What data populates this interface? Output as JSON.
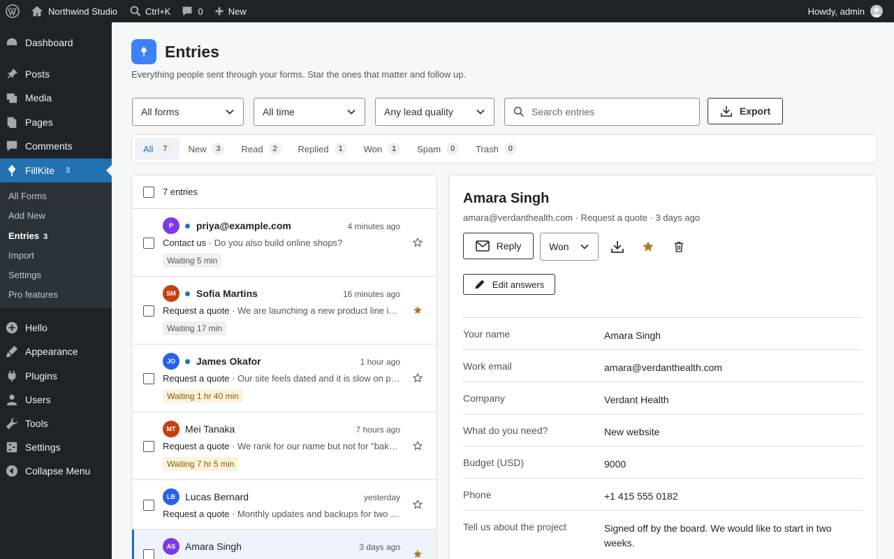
{
  "adminbar": {
    "site_name": "Northwind Studio",
    "search_shortcut": "Ctrl+K",
    "comments_count": "0",
    "new_label": "New",
    "howdy": "Howdy, admin"
  },
  "sidebar": {
    "items": [
      {
        "label": "Dashboard",
        "icon": "dashboard-icon"
      },
      {
        "label": "Posts",
        "icon": "pin-icon"
      },
      {
        "label": "Media",
        "icon": "media-icon"
      },
      {
        "label": "Pages",
        "icon": "pages-icon"
      },
      {
        "label": "Comments",
        "icon": "comment-icon"
      },
      {
        "label": "FillKite",
        "icon": "kite-icon",
        "count": "3"
      },
      {
        "label": "Hello",
        "icon": "plus-circle-icon"
      },
      {
        "label": "Appearance",
        "icon": "brush-icon"
      },
      {
        "label": "Plugins",
        "icon": "plugin-icon"
      },
      {
        "label": "Users",
        "icon": "user-icon"
      },
      {
        "label": "Tools",
        "icon": "wrench-icon"
      },
      {
        "label": "Settings",
        "icon": "settings-icon"
      },
      {
        "label": "Collapse Menu",
        "icon": "collapse-icon"
      }
    ],
    "submenu": [
      {
        "label": "All Forms"
      },
      {
        "label": "Add New"
      },
      {
        "label": "Entries",
        "count": "3"
      },
      {
        "label": "Import"
      },
      {
        "label": "Settings"
      },
      {
        "label": "Pro features"
      }
    ]
  },
  "header": {
    "title": "Entries",
    "subtitle": "Everything people sent through your forms. Star the ones that matter and follow up."
  },
  "filters": {
    "forms": "All forms",
    "time": "All time",
    "quality": "Any lead quality",
    "search_placeholder": "Search entries",
    "export_label": "Export"
  },
  "tabs": [
    {
      "label": "All",
      "count": "7"
    },
    {
      "label": "New",
      "count": "3"
    },
    {
      "label": "Read",
      "count": "2"
    },
    {
      "label": "Replied",
      "count": "1"
    },
    {
      "label": "Won",
      "count": "1"
    },
    {
      "label": "Spam",
      "count": "0"
    },
    {
      "label": "Trash",
      "count": "0"
    }
  ],
  "list": {
    "count_label": "7 entries",
    "entries": [
      {
        "initials": "P",
        "color": "#7c3aed",
        "name": "priya@example.com",
        "time": "4 minutes ago",
        "form": "Contact us",
        "message": "Do you also build online shops?",
        "wait": "Waiting 5 min",
        "starred": false
      },
      {
        "initials": "SM",
        "color": "#c2410c",
        "name": "Sofia Martins",
        "time": "16 minutes ago",
        "form": "Request a quote",
        "message": "We are launching a new product line in the spring and need a site",
        "wait": "Waiting 17 min",
        "starred": true
      },
      {
        "initials": "JO",
        "color": "#2563eb",
        "name": "James Okafor",
        "time": "1 hour ago",
        "form": "Request a quote",
        "message": "Our site feels dated and it is slow on phones",
        "wait": "Waiting 1 hr 40 min",
        "starred": false
      },
      {
        "initials": "MT",
        "color": "#c2410c",
        "name": "Mei Tanaka",
        "time": "7 hours ago",
        "form": "Request a quote",
        "message": "We rank for our name but not for \"bakery near me\"",
        "wait": "Waiting 7 hr 5 min",
        "starred": false
      },
      {
        "initials": "LB",
        "color": "#2563eb",
        "name": "Lucas Bernard",
        "time": "yesterday",
        "form": "Request a quote",
        "message": "Monthly updates and backups for two sites",
        "starred": false
      },
      {
        "initials": "AS",
        "color": "#7c3aed",
        "name": "Amara Singh",
        "time": "3 days ago",
        "starred": true
      }
    ]
  },
  "detail": {
    "name": "Amara Singh",
    "meta": "amara@verdanthealth.com · Request a quote · 3 days ago",
    "reply_label": "Reply",
    "status": "Won",
    "edit_label": "Edit answers",
    "fields": [
      {
        "label": "Your name",
        "value": "Amara Singh"
      },
      {
        "label": "Work email",
        "value": "amara@verdanthealth.com"
      },
      {
        "label": "Company",
        "value": "Verdant Health"
      },
      {
        "label": "What do you need?",
        "value": "New website"
      },
      {
        "label": "Budget (USD)",
        "value": "9000"
      },
      {
        "label": "Phone",
        "value": "+1 415 555 0182"
      },
      {
        "label": "Tell us about the project",
        "value": "Signed off by the board. We would like to start in two weeks."
      }
    ]
  },
  "colors": {
    "accent": "#2271b1",
    "star": "#b7791f",
    "brand": "#3b82f6"
  }
}
